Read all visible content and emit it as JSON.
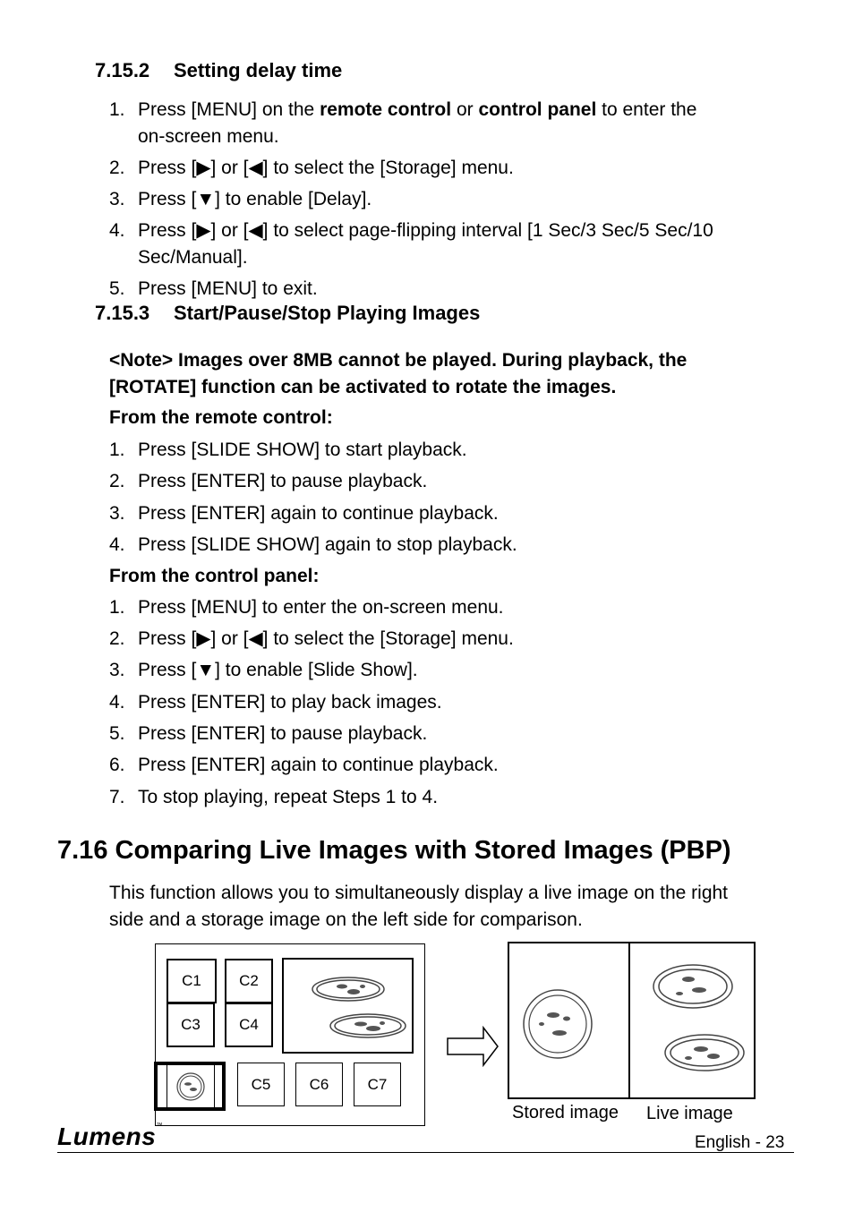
{
  "section_7_15_2": {
    "number": "7.15.2",
    "title": "Setting delay time",
    "steps": [
      {
        "n": "1.",
        "parts": [
          "Press [MENU] on the ",
          "remote control",
          " or ",
          "control panel",
          " to enter the"
        ],
        "cont": "on-screen menu."
      },
      {
        "n": "2.",
        "text": "Press [▶] or [◀] to select the [Storage] menu."
      },
      {
        "n": "3.",
        "text": "Press [▼] to enable [Delay]."
      },
      {
        "n": "4.",
        "text": "Press [▶] or [◀] to select page-flipping interval [1 Sec/3 Sec/5 Sec/10",
        "cont": "Sec/Manual]."
      },
      {
        "n": "5.",
        "text": "Press [MENU] to exit."
      }
    ]
  },
  "section_7_15_3": {
    "number": "7.15.3",
    "title": "Start/Pause/Stop Playing Images",
    "note_line1": "<Note> Images over 8MB cannot be played. During playback, the",
    "note_line2": "[ROTATE] function can be activated to rotate the images.",
    "remote_heading": "From the remote control:",
    "remote_steps": [
      {
        "n": "1.",
        "text": "Press [SLIDE SHOW] to start playback."
      },
      {
        "n": "2.",
        "text": "Press [ENTER] to pause playback."
      },
      {
        "n": "3.",
        "text": "Press [ENTER] again to continue playback."
      },
      {
        "n": "4.",
        "text": "Press [SLIDE SHOW] again to stop playback."
      }
    ],
    "panel_heading": "From the control panel:",
    "panel_steps": [
      {
        "n": "1.",
        "text": "Press [MENU] to enter the on-screen menu."
      },
      {
        "n": "2.",
        "text": "Press [▶] or [◀] to select the [Storage] menu."
      },
      {
        "n": "3.",
        "text": "Press [▼] to enable [Slide Show]."
      },
      {
        "n": "4.",
        "text": "Press [ENTER] to play back images."
      },
      {
        "n": "5.",
        "text": "Press [ENTER] to pause playback."
      },
      {
        "n": "6.",
        "text": "Press [ENTER] again to continue playback."
      },
      {
        "n": "7.",
        "text": "To stop playing, repeat Steps 1 to 4."
      }
    ]
  },
  "section_7_16": {
    "title": "7.16 Comparing Live Images with Stored Images (PBP)",
    "para_line1": "This function allows you to simultaneously display a live image on the right",
    "para_line2": "side and a storage image on the left side for comparison."
  },
  "diagram": {
    "thumbnails": [
      "C1",
      "C2",
      "C3",
      "C4",
      "C5",
      "C6",
      "C7"
    ],
    "stored_caption": "Stored image",
    "live_caption": "Live image",
    "arrow_icon": "right-arrow-outline"
  },
  "footer": {
    "logo": "Lumens",
    "trademark": "™",
    "page_label": "English - 23"
  }
}
